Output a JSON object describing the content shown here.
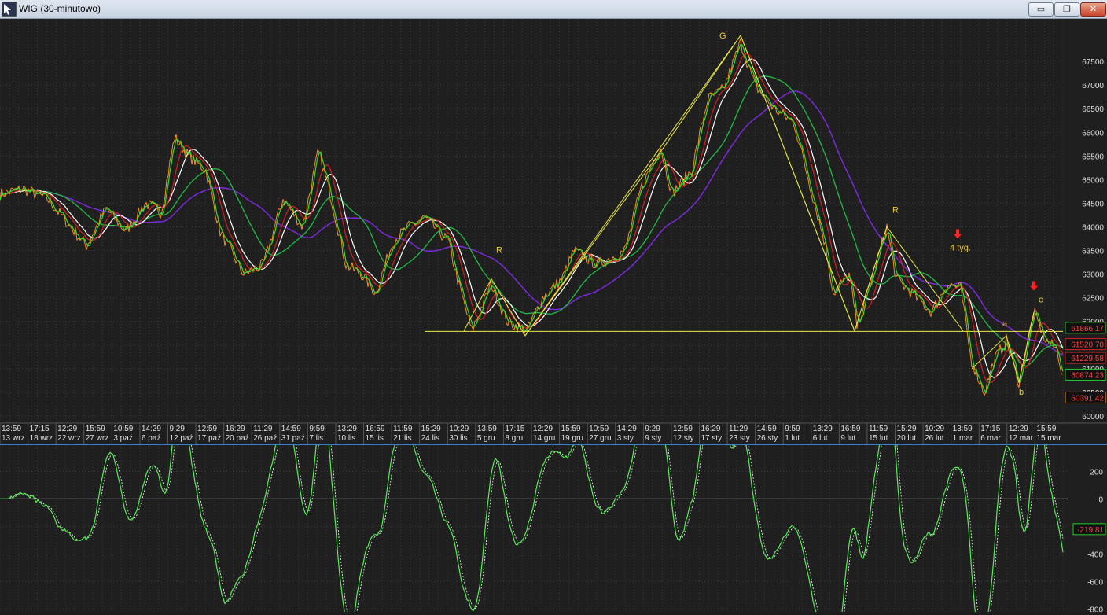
{
  "window": {
    "title": "WIG (30-minutowo)",
    "buttons": {
      "minimize": "▭",
      "restore": "❐",
      "close": "✕"
    }
  },
  "colors": {
    "background": "#1f1f1f",
    "grid": "#3a3a3a",
    "price_green": "#33dd33",
    "price_orange": "#ff8c1a",
    "ma_white": "#ffffff",
    "ma_red": "#d42020",
    "ma_green": "#22bb44",
    "ma_purple": "#7a2ad8",
    "pattern_yellow": "#e8e84a",
    "osc_line": "#55ee55"
  },
  "price_chart": {
    "y_ticks": [
      "67500",
      "67000",
      "66500",
      "66000",
      "65500",
      "65000",
      "64500",
      "64000",
      "63500",
      "63000",
      "62500",
      "62000",
      "61500",
      "61000",
      "60500",
      "60000"
    ],
    "y_tick_values": [
      67500,
      67000,
      66500,
      66000,
      65500,
      65000,
      64500,
      64000,
      63500,
      63000,
      62500,
      62000,
      61500,
      61000,
      60500,
      60000
    ],
    "y_range": [
      59850,
      68400
    ],
    "time_labels": [
      "13:59",
      "17:15",
      "12:29",
      "15:59",
      "10:59",
      "14:29",
      "9:29",
      "12:59",
      "16:29",
      "11:29",
      "14:59",
      "9:59",
      "13:29",
      "16:59",
      "11:59",
      "15:29",
      "10:29",
      "13:59",
      "17:15",
      "12:29",
      "15:59",
      "10:59",
      "14:29",
      "9:29",
      "12:59",
      "16:29",
      "11:29",
      "14:59",
      "9:59",
      "13:29",
      "16:59",
      "11:59",
      "15:29",
      "10:29",
      "13:59",
      "17:15",
      "12:29",
      "15:59"
    ],
    "date_labels": [
      "13 wrz",
      "18 wrz",
      "22 wrz",
      "27 wrz",
      "3 paź",
      "6 paź",
      "12 paź",
      "17 paź",
      "20 paź",
      "26 paź",
      "31 paź",
      "7 lis",
      "10 lis",
      "15 lis",
      "21 lis",
      "24 lis",
      "30 lis",
      "5 gru",
      "8 gru",
      "14 gru",
      "19 gru",
      "27 gru",
      "3 sty",
      "9 sty",
      "12 sty",
      "17 sty",
      "23 sty",
      "26 sty",
      "1 lut",
      "6 lut",
      "9 lut",
      "15 lut",
      "20 lut",
      "26 lut",
      "1 mar",
      "6 mar",
      "12 mar",
      "15 mar"
    ],
    "annotations": {
      "G": "G",
      "R1": "R",
      "R2": "R",
      "weeks": "4 tyg.",
      "a": "a",
      "b": "b",
      "c": "c"
    },
    "price_labels": [
      {
        "text": "61866.17",
        "value": 61866.17,
        "border": "#22cc22",
        "color": "#ff4444"
      },
      {
        "text": "61520.70",
        "value": 61520.7,
        "border": "#cc2222",
        "color": "#ff4444"
      },
      {
        "text": "61229.58",
        "value": 61229.58,
        "border": "#cc2222",
        "color": "#ff4444"
      },
      {
        "text": "60874.23",
        "value": 60874.23,
        "border": "#22cc22",
        "color": "#ff4444"
      },
      {
        "text": "60391.42",
        "value": 60391.42,
        "border": "#ff8c1a",
        "color": "#ff4444"
      }
    ],
    "support_level": 61790
  },
  "oscillator": {
    "y_ticks": [
      "200",
      "0",
      "-200",
      "-400",
      "-600",
      "-800"
    ],
    "y_tick_values": [
      200,
      0,
      -200,
      -400,
      -600,
      -800
    ],
    "y_range": [
      -810,
      380
    ],
    "current_label": "-219.81",
    "current_value": -219.81
  }
}
